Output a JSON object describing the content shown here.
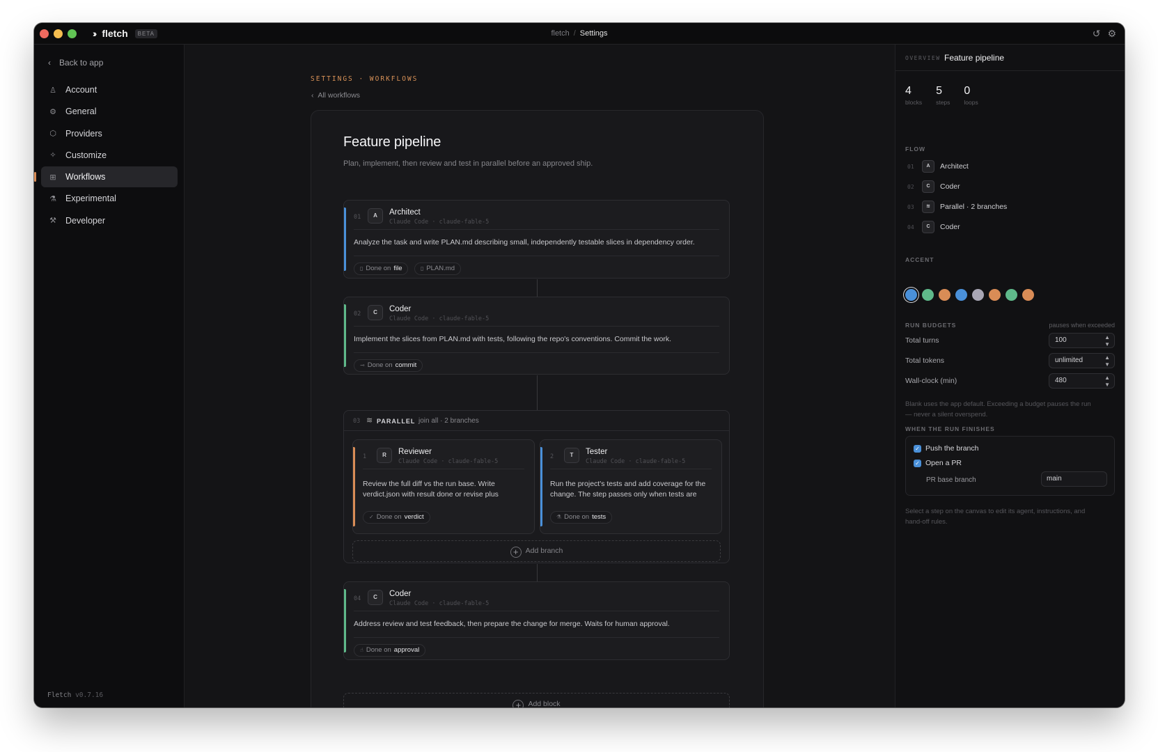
{
  "titlebar": {
    "brand": "fletch",
    "badge": "BETA",
    "crumb_root": "fletch",
    "crumb_sep": "/",
    "crumb_current": "Settings",
    "icons": [
      "history-icon",
      "gear-icon"
    ]
  },
  "sidebar": {
    "back_label": "Back to app",
    "items": [
      {
        "label": "Account",
        "icon": "user-icon"
      },
      {
        "label": "General",
        "icon": "gear-icon"
      },
      {
        "label": "Providers",
        "icon": "cube-icon"
      },
      {
        "label": "Customize",
        "icon": "sparkles-icon"
      },
      {
        "label": "Workflows",
        "icon": "grid-icon",
        "active": true
      },
      {
        "label": "Experimental",
        "icon": "flask-icon"
      },
      {
        "label": "Developer",
        "icon": "wrench-icon"
      }
    ],
    "app_name": "Fletch",
    "version": "v0.7.16"
  },
  "main": {
    "eyebrow": "SETTINGS · WORKFLOWS",
    "back_label": "All workflows",
    "title": "Feature pipeline",
    "description": "Plan, implement, then review and test in parallel before an approved ship.",
    "blocks": [
      {
        "num": "01",
        "avatar": "A",
        "name": "Architect",
        "meta": "Claude Code · claude-fable-5",
        "text": "Analyze the task and write PLAN.md describing small, independently testable slices in dependency order.",
        "done_label": "Done on",
        "done_value": "file",
        "extra_chip": "PLAN.md",
        "accent": "#4a90d9"
      },
      {
        "num": "02",
        "avatar": "C",
        "name": "Coder",
        "meta": "Claude Code · claude-fable-5",
        "text": "Implement the slices from PLAN.md with tests, following the repo's conventions. Commit the work.",
        "done_label": "Done on",
        "done_value": "commit",
        "accent": "#5fb98a"
      },
      {
        "num": "04",
        "avatar": "C",
        "name": "Coder",
        "meta": "Claude Code · claude-fable-5",
        "text": "Address review and test feedback, then prepare the change for merge. Waits for human approval.",
        "done_label": "Done on",
        "done_value": "approval",
        "accent": "#5fb98a"
      }
    ],
    "parallel": {
      "num": "03",
      "label": "PARALLEL",
      "info": "join all · 2 branches",
      "branches": [
        {
          "num": "1",
          "avatar": "R",
          "name": "Reviewer",
          "meta": "Claude Code · claude-fable-5",
          "text": "Review the full diff vs the run base. Write verdict.json with result done or revise plus concrete feedback.",
          "done_label": "Done on",
          "done_value": "verdict",
          "accent": "#d98c56"
        },
        {
          "num": "2",
          "avatar": "T",
          "name": "Tester",
          "meta": "Claude Code · claude-fable-5",
          "text": "Run the project's tests and add coverage for the change. The step passes only when tests are green.",
          "done_label": "Done on",
          "done_value": "tests",
          "accent": "#4a90d9"
        }
      ],
      "add_branch": "Add branch"
    },
    "add_block": "Add block"
  },
  "right": {
    "eyebrow": "OVERVIEW",
    "title": "Feature pipeline",
    "stats": [
      {
        "n": "4",
        "l": "blocks"
      },
      {
        "n": "5",
        "l": "steps"
      },
      {
        "n": "0",
        "l": "loops"
      }
    ],
    "flow_label": "FLOW",
    "flow": [
      {
        "num": "01",
        "avatar": "A",
        "name": "Architect"
      },
      {
        "num": "02",
        "avatar": "C",
        "name": "Coder"
      },
      {
        "num": "03",
        "avatar": "≋",
        "name": "Parallel · 2 branches"
      },
      {
        "num": "04",
        "avatar": "C",
        "name": "Coder"
      }
    ],
    "accent_label": "ACCENT",
    "accent_colors": [
      "#4a90d9",
      "#5fb98a",
      "#d98c56",
      "#4a90d9",
      "#a8a6b4",
      "#d98c56",
      "#5fb98a",
      "#d98c56"
    ],
    "budgets_label": "RUN BUDGETS",
    "budgets_note": "pauses when exceeded",
    "budgets": [
      {
        "label": "Total turns",
        "value": "100"
      },
      {
        "label": "Total tokens",
        "value": "unlimited"
      },
      {
        "label": "Wall-clock (min)",
        "value": "480"
      }
    ],
    "budget_hint": "Blank uses the app default. Exceeding a budget pauses the run — never a silent overspend.",
    "finish_label": "WHEN THE RUN FINISHES",
    "finish": [
      {
        "label": "Push the branch",
        "checked": true
      },
      {
        "label": "Open a PR",
        "checked": true
      }
    ],
    "pr_label": "PR base branch",
    "pr_value": "main",
    "footer_hint": "Select a step on the canvas to edit its agent, instructions, and hand-off rules."
  }
}
